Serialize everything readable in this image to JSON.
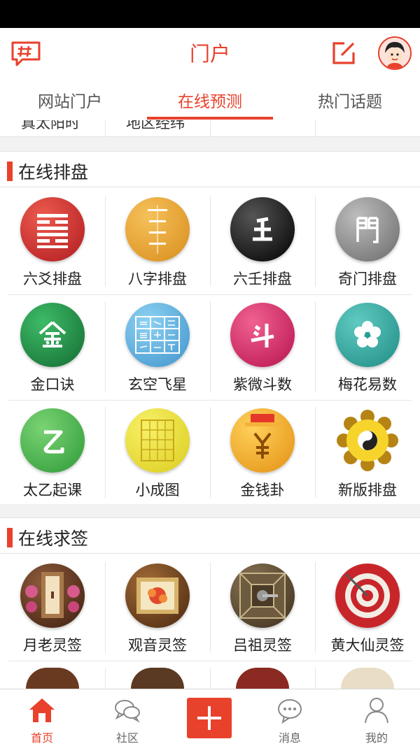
{
  "header": {
    "title": "门户",
    "hash_icon": "topic-hash-icon",
    "edit_icon": "compose-edit-icon",
    "avatar_icon": "user-avatar-icon"
  },
  "tabs": [
    {
      "label": "网站门户",
      "active": false
    },
    {
      "label": "在线预测",
      "active": true
    },
    {
      "label": "热门话题",
      "active": false
    }
  ],
  "partial_row": [
    "真太阳时",
    "地区经纬"
  ],
  "sections": [
    {
      "title": "在线排盘",
      "items": [
        {
          "label": "六爻排盘",
          "icon": "hexagram-icon",
          "color": "#c9252b"
        },
        {
          "label": "八字排盘",
          "icon": "bazi-scroll-icon",
          "color": "#e6a32f"
        },
        {
          "label": "六壬排盘",
          "icon": "ren-character-icon",
          "color": "#111111"
        },
        {
          "label": "奇门排盘",
          "icon": "men-gate-icon",
          "color": "#8d8d8d"
        },
        {
          "label": "金口诀",
          "icon": "jin-character-icon",
          "color": "#1c8a45"
        },
        {
          "label": "玄空飞星",
          "icon": "nine-grid-icon",
          "color": "#5fb2e0"
        },
        {
          "label": "紫微斗数",
          "icon": "dou-character-icon",
          "color": "#d3356f"
        },
        {
          "label": "梅花易数",
          "icon": "plum-blossom-icon",
          "color": "#3ba9a0"
        },
        {
          "label": "太乙起课",
          "icon": "yi-character-icon",
          "color": "#4bb84e"
        },
        {
          "label": "小成图",
          "icon": "grid-paper-icon",
          "color": "#ece43a"
        },
        {
          "label": "金钱卦",
          "icon": "coin-bag-icon",
          "color": "#f0a526"
        },
        {
          "label": "新版排盘",
          "icon": "bagua-flower-icon",
          "color": "#f5d230"
        }
      ]
    },
    {
      "title": "在线求签",
      "items": [
        {
          "label": "月老灵签",
          "icon": "yuelao-shrine-icon",
          "color": "#6b3a24"
        },
        {
          "label": "观音灵签",
          "icon": "guanyin-frame-icon",
          "color": "#7a4a22"
        },
        {
          "label": "吕祖灵签",
          "icon": "lvzu-box-icon",
          "color": "#5a4630"
        },
        {
          "label": "黄大仙灵签",
          "icon": "target-icon",
          "color": "#b7262a"
        }
      ]
    }
  ],
  "bottom_nav": [
    {
      "label": "首页",
      "icon": "home-icon",
      "active": true
    },
    {
      "label": "社区",
      "icon": "chat-bubbles-icon",
      "active": false
    },
    {
      "label": "",
      "icon": "add-plus-icon",
      "active": false
    },
    {
      "label": "消息",
      "icon": "message-icon",
      "active": false
    },
    {
      "label": "我的",
      "icon": "profile-icon",
      "active": false
    }
  ]
}
